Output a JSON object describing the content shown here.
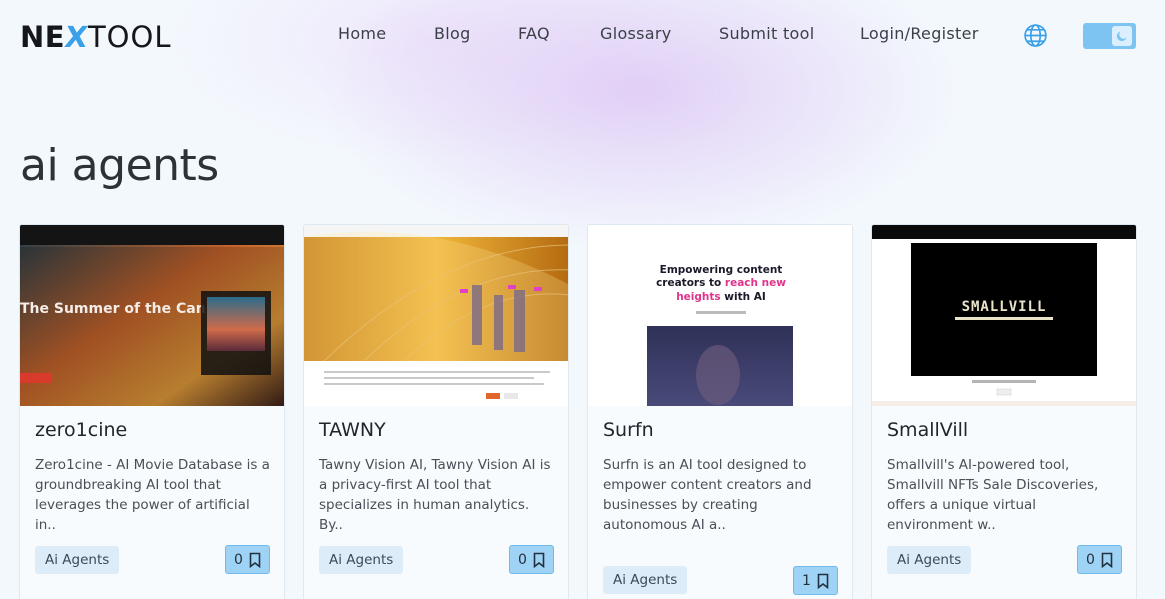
{
  "header": {
    "logo": {
      "part1": "NE",
      "part2": "X",
      "part3": "TOOL"
    },
    "nav": [
      {
        "label": "Home"
      },
      {
        "label": "Blog"
      },
      {
        "label": "FAQ"
      },
      {
        "label": "Glossary"
      },
      {
        "label": "Submit tool"
      },
      {
        "label": "Login/Register"
      }
    ],
    "language_icon": "globe-icon",
    "theme_icon": "moon-icon"
  },
  "page_title": "ai agents",
  "cards": [
    {
      "title": "zero1cine",
      "description": "Zero1cine - AI Movie Database is a groundbreaking AI tool that leverages the power of artificial in..",
      "tag": "Ai Agents",
      "saves": "0",
      "thumb_text": "The Summer of the Can"
    },
    {
      "title": "TAWNY",
      "description": "Tawny Vision AI, Tawny Vision AI is a privacy-first AI tool that specializes in human analytics. By..",
      "tag": "Ai Agents",
      "saves": "0"
    },
    {
      "title": "Surfn",
      "description": "Surfn is an AI tool designed to empower content creators and businesses by creating autonomous AI a..",
      "tag": "Ai Agents",
      "saves": "1",
      "thumb_text_1": "Empowering content",
      "thumb_text_2": "creators to ",
      "thumb_text_3": "reach new",
      "thumb_text_4": "heights",
      "thumb_text_5": " with AI"
    },
    {
      "title": "SmallVill",
      "description": "Smallvill's AI-powered tool, Smallvill NFTs Sale Discoveries, offers a unique virtual environment w..",
      "tag": "Ai Agents",
      "saves": "0",
      "thumb_text": "SMALLVILL"
    }
  ],
  "colors": {
    "accent": "#3aa0e8",
    "tag_bg": "#dcecf8",
    "save_bg": "#9fd3f6",
    "page_bg": "#f3f8fd"
  }
}
